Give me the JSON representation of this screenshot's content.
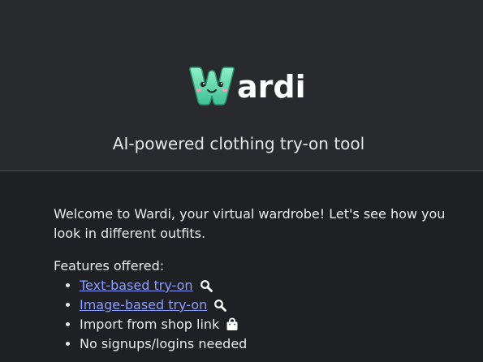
{
  "header": {
    "logo_text": "ardi",
    "logo_mark_icon": "smiling-w-mascot-icon",
    "tagline": "AI-powered clothing try-on tool"
  },
  "content": {
    "intro": "Welcome to Wardi, your virtual wardrobe! Let's see how you look in different outfits.",
    "features_label": "Features offered:",
    "features": [
      {
        "label": "Text-based try-on",
        "is_link": true,
        "icon": "magnifier-icon"
      },
      {
        "label": "Image-based try-on",
        "is_link": true,
        "icon": "magnifier-icon"
      },
      {
        "label": "Import from shop link",
        "is_link": false,
        "icon": "shopping-bag-icon"
      },
      {
        "label": "No signups/logins needed",
        "is_link": false,
        "icon": ""
      }
    ]
  },
  "colors": {
    "header_bg": "#292a2d",
    "page_bg": "#1f2023",
    "link": "#8a9cff",
    "logo_mark": "#5fd1a9"
  }
}
